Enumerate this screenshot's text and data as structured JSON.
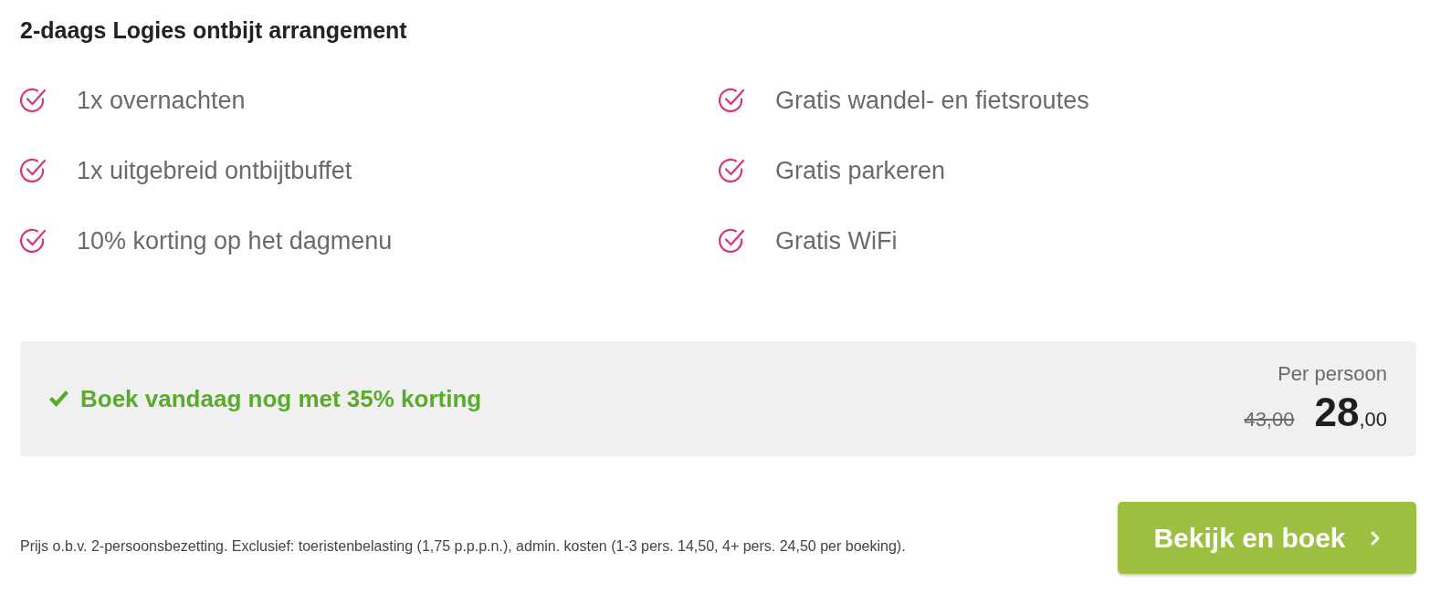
{
  "title": "2-daags Logies ontbijt arrangement",
  "features": [
    {
      "label": "1x overnachten"
    },
    {
      "label": "Gratis wandel- en fietsroutes"
    },
    {
      "label": "1x uitgebreid ontbijtbuffet"
    },
    {
      "label": "Gratis parkeren"
    },
    {
      "label": "10% korting op het dagmenu"
    },
    {
      "label": "Gratis WiFi"
    }
  ],
  "promo": {
    "text": "Boek vandaag nog met 35% korting",
    "price_label": "Per persoon",
    "old_price": "43,00",
    "price": "28",
    "price_cents": ",00"
  },
  "footnote": "Prijs o.b.v. 2-persoonsbezetting. Exclusief: toeristenbelasting (1,75 p.p.p.n.), admin. kosten (1-3 pers. 14,50, 4+ pers. 24,50 per boeking).",
  "button": {
    "label": "Bekijk en boek"
  }
}
